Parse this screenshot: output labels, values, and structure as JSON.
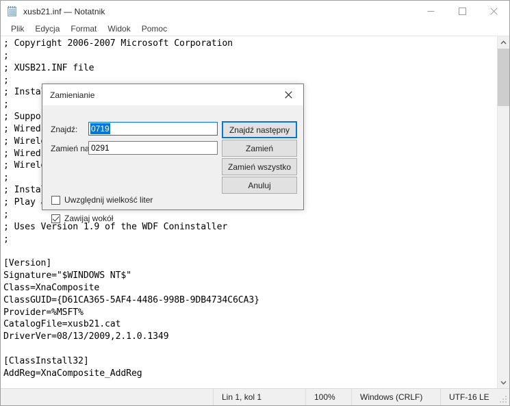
{
  "window": {
    "title": "xusb21.inf — Notatnik",
    "icon": "notepad-icon",
    "controls": {
      "minimize": "minimize-icon",
      "maximize": "maximize-icon",
      "close": "close-icon"
    }
  },
  "menubar": {
    "items": [
      {
        "label": "Plik"
      },
      {
        "label": "Edycja"
      },
      {
        "label": "Format"
      },
      {
        "label": "Widok"
      },
      {
        "label": "Pomoc"
      }
    ]
  },
  "editor": {
    "text": "; Copyright 2006-2007 Microsoft Corporation\n;\n; XUSB21.INF file\n;\n; Installs the XBOX 360 Controller\n;\n; Supports:\n; Wired Common Controller\n; Wireless Common Controller\n; Wired Headset\n; Wireless Headset\n;\n; Installs the XBOX 360 Controller for Windows and the\n; Play and Charge Kit\n;\n; Uses Version 1.9 of the WDF Coninstaller\n;\n\n[Version]\nSignature=\"$WINDOWS NT$\"\nClass=XnaComposite\nClassGUID={D61CA365-5AF4-4486-998B-9DB4734C6CA3}\nProvider=%MSFT%\nCatalogFile=xusb21.cat\nDriverVer=08/13/2009,2.1.0.1349\n\n[ClassInstall32]\nAddReg=XnaComposite_AddReg"
  },
  "scrollbar": {
    "up_arrow": "chevron-up-icon",
    "down_arrow": "chevron-down-icon"
  },
  "statusbar": {
    "position": "Lin 1, kol 1",
    "zoom": "100%",
    "line_ending": "Windows (CRLF)",
    "encoding": "UTF-16 LE"
  },
  "dialog": {
    "title": "Zamienianie",
    "close_icon": "close-icon",
    "find_label": "Znajdź:",
    "find_value": "0719",
    "replace_label": "Zamień na:",
    "replace_value": "0291",
    "buttons": {
      "find_next": "Znajdź następny",
      "replace": "Zamień",
      "replace_all": "Zamień wszystko",
      "cancel": "Anuluj"
    },
    "checkboxes": {
      "match_case": {
        "label": "Uwzględnij wielkość liter",
        "checked": false
      },
      "wrap_around": {
        "label": "Zawijaj wokół",
        "checked": true
      }
    }
  },
  "colors": {
    "accent": "#0078d7",
    "window_bg": "#ffffff",
    "dialog_bg": "#f0f0f0",
    "status_bg": "#f0f0f0",
    "scroll_thumb": "#cdcdcd"
  }
}
